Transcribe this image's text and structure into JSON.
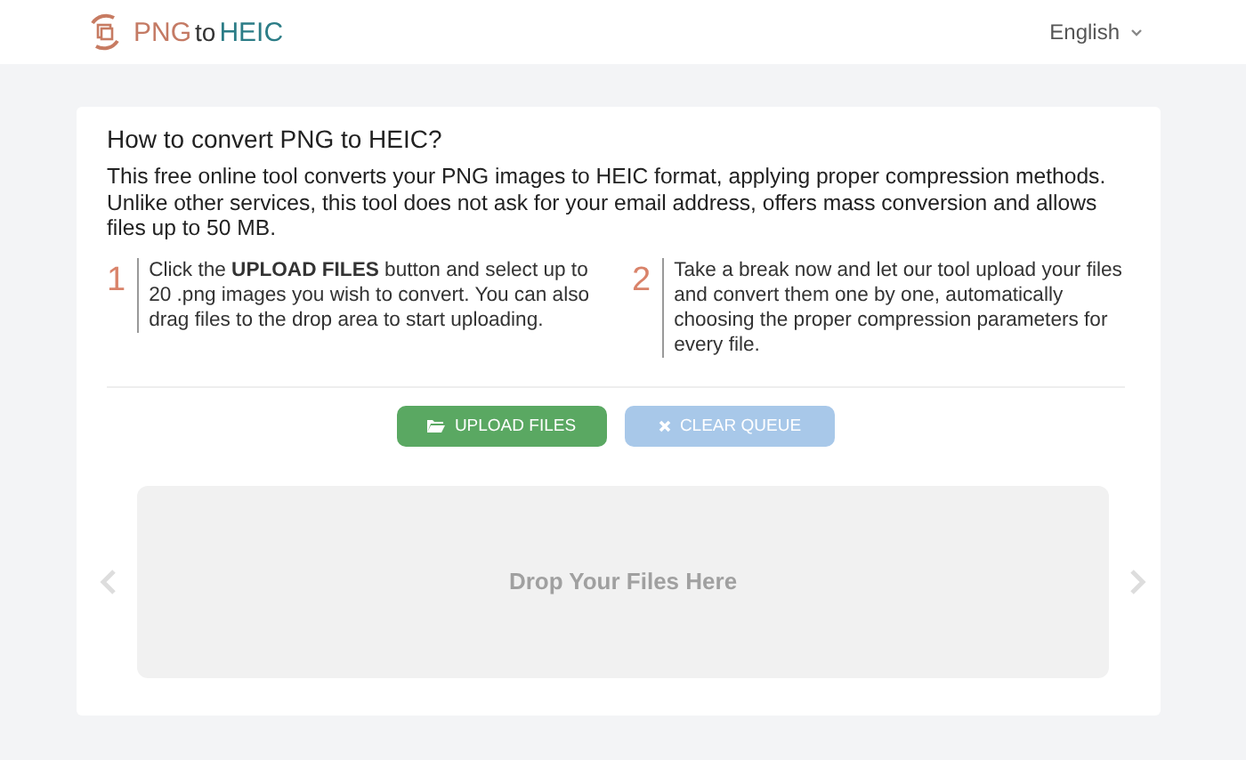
{
  "header": {
    "logo": [
      {
        "text": "PNG",
        "kind": "source"
      },
      {
        "text": "to",
        "kind": "joiner"
      },
      {
        "text": "HEIC",
        "kind": "target"
      }
    ],
    "language": "English"
  },
  "card": {
    "title": "How to convert PNG to HEIC?",
    "intro": "This free online tool converts your PNG images to HEIC format, applying proper compression methods. Unlike other services, this tool does not ask for your email address, offers mass conversion and allows files up to 50 MB.",
    "steps": [
      {
        "number": "1",
        "text": "Click the **UPLOAD FILES** button and select up to 20 .png images you wish to convert. You can also drag files to the drop area to start uploading."
      },
      {
        "number": "2",
        "text": "Take a break now and let our tool upload your files and convert them one by one, automatically choosing the proper compression parameters for every file."
      }
    ],
    "buttons": [
      {
        "label": "UPLOAD FILES",
        "kind": "upload",
        "disabled": false
      },
      {
        "label": "CLEAR QUEUE",
        "kind": "clear",
        "disabled": true
      }
    ],
    "drop_zone": {
      "text": "Drop Your Files Here"
    }
  }
}
